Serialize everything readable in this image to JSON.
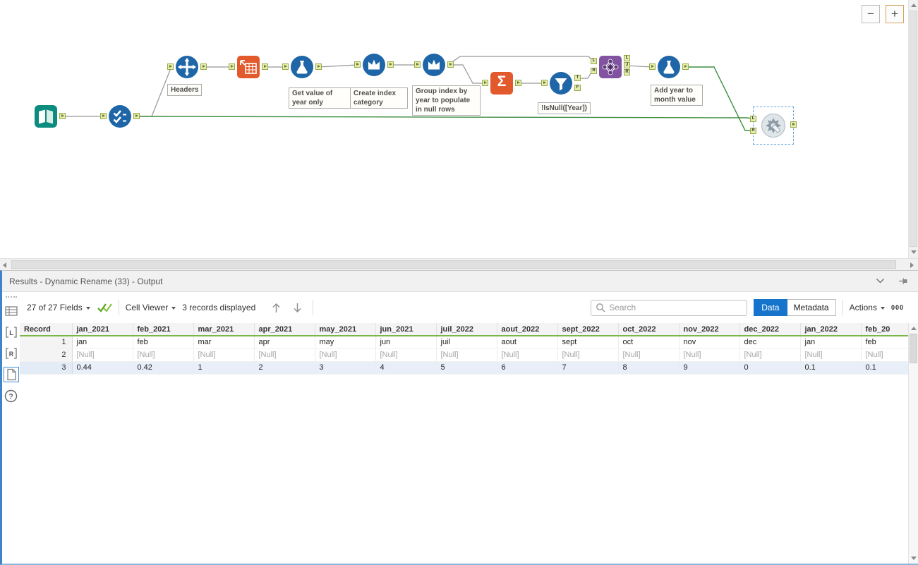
{
  "app": {
    "zoom_out_label": "−",
    "zoom_in_label": "+"
  },
  "workflow": {
    "labels": {
      "headers": "Headers",
      "formula_year": "Get value of year only",
      "multirow_index": "Create index category",
      "multirow_group": "Group index by year to populate in null rows",
      "filter": "!IsNull([Year])",
      "formula_month": "Add year to month value"
    },
    "summarize_glyph": "Σ",
    "anchor_letters": {
      "L": "L",
      "R": "R",
      "J": "J",
      "T": "T",
      "F": "F"
    }
  },
  "results": {
    "title": "Results - Dynamic Rename (33) - Output",
    "toolbar": {
      "fields_summary": "27 of 27 Fields",
      "cell_viewer_label": "Cell Viewer",
      "records_displayed": "3 records displayed",
      "search_placeholder": "Search",
      "data_button_label": "Data",
      "metadata_button_label": "Metadata",
      "actions_label": "Actions",
      "encoding_label": "000"
    },
    "sidebar": {
      "left_anchor": "L",
      "right_anchor": "R",
      "help": "?"
    },
    "table": {
      "columns": [
        "Record",
        "jan_2021",
        "feb_2021",
        "mar_2021",
        "apr_2021",
        "may_2021",
        "jun_2021",
        "juil_2022",
        "aout_2022",
        "sept_2022",
        "oct_2022",
        "nov_2022",
        "dec_2022",
        "jan_2022",
        "feb_20"
      ],
      "rows": [
        {
          "record": "1",
          "cells": [
            "jan",
            "feb",
            "mar",
            "apr",
            "may",
            "jun",
            "juil",
            "aout",
            "sept",
            "oct",
            "nov",
            "dec",
            "jan",
            "feb"
          ]
        },
        {
          "record": "2",
          "cells": [
            "[Null]",
            "[Null]",
            "[Null]",
            "[Null]",
            "[Null]",
            "[Null]",
            "[Null]",
            "[Null]",
            "[Null]",
            "[Null]",
            "[Null]",
            "[Null]",
            "[Null]",
            "[Null]"
          ]
        },
        {
          "record": "3",
          "cells": [
            "0.44",
            "0.42",
            "1",
            "2",
            "3",
            "4",
            "5",
            "6",
            "7",
            "8",
            "9",
            "0",
            "0.1",
            "0.1"
          ]
        }
      ]
    }
  }
}
